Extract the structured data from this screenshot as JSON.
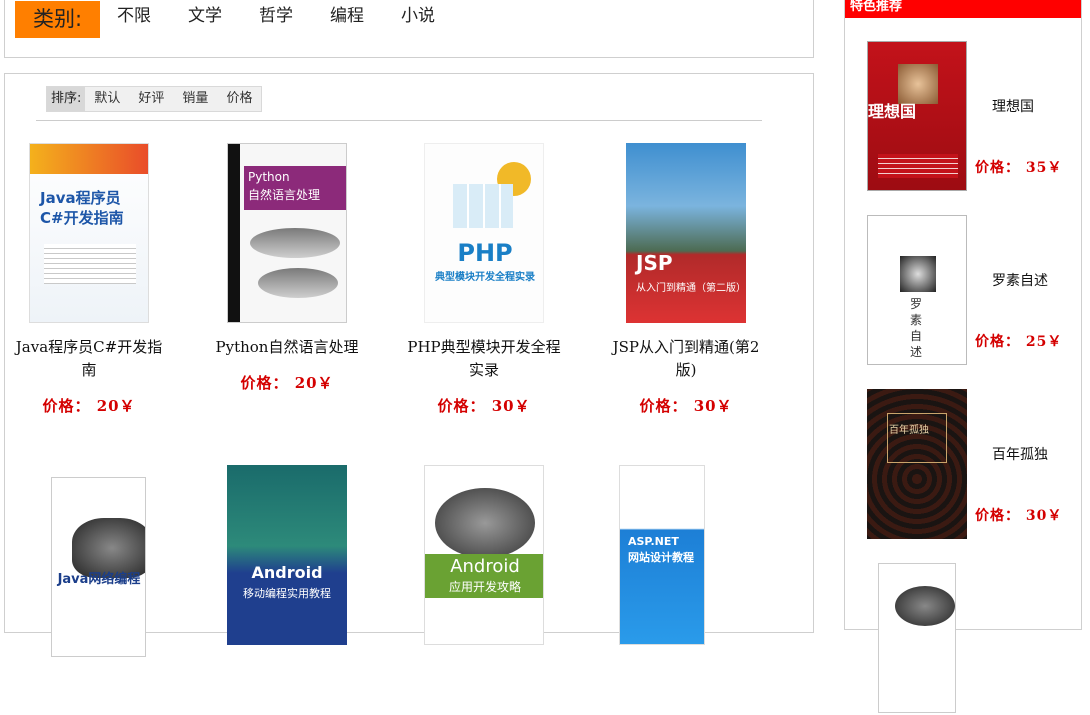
{
  "category": {
    "label": "类别:",
    "items": [
      "不限",
      "文学",
      "哲学",
      "编程",
      "小说"
    ]
  },
  "sort": {
    "label": "排序:",
    "items": [
      "默认",
      "好评",
      "销量",
      "价格"
    ]
  },
  "books": [
    {
      "title": "Java程序员C#开发指南",
      "price_label": "价格：",
      "price": "20￥",
      "cover": {
        "line1": "Java程序员",
        "line2": "C#开发指南"
      }
    },
    {
      "title": "Python自然语言处理",
      "price_label": "价格：",
      "price": "20￥",
      "cover": {
        "line1": "Python",
        "line2": "自然语言处理"
      }
    },
    {
      "title": "PHP典型模块开发全程实录",
      "price_label": "价格：",
      "price": "30￥",
      "cover": {
        "line1": "PHP",
        "line2": "典型模块开发全程实录"
      }
    },
    {
      "title": "JSP从入门到精通(第2版)",
      "price_label": "价格：",
      "price": "30￥",
      "cover": {
        "line1": "JSP",
        "line2": "从入门到精通（第二版）"
      }
    },
    {
      "cover": {
        "line1": "Java网络编程"
      }
    },
    {
      "cover": {
        "line1": "Android",
        "line2": "移动编程实用教程"
      }
    },
    {
      "cover": {
        "line1": "Android",
        "line2": "应用开发攻略"
      }
    },
    {
      "cover": {
        "line1": "ASP.NET",
        "line2": "网站设计教程"
      }
    }
  ],
  "sidebar": {
    "title": "特色推荐",
    "items": [
      {
        "title": "理想国",
        "price_label": "价格：",
        "price": "35￥",
        "cover": {
          "line1": "理想国"
        }
      },
      {
        "title": "罗素自述",
        "price_label": "价格：",
        "price": "25￥",
        "cover": {
          "line1": "罗素自述"
        }
      },
      {
        "title": "百年孤独",
        "price_label": "价格：",
        "price": "30￥",
        "cover": {
          "line1": "百年孤独"
        }
      }
    ]
  }
}
